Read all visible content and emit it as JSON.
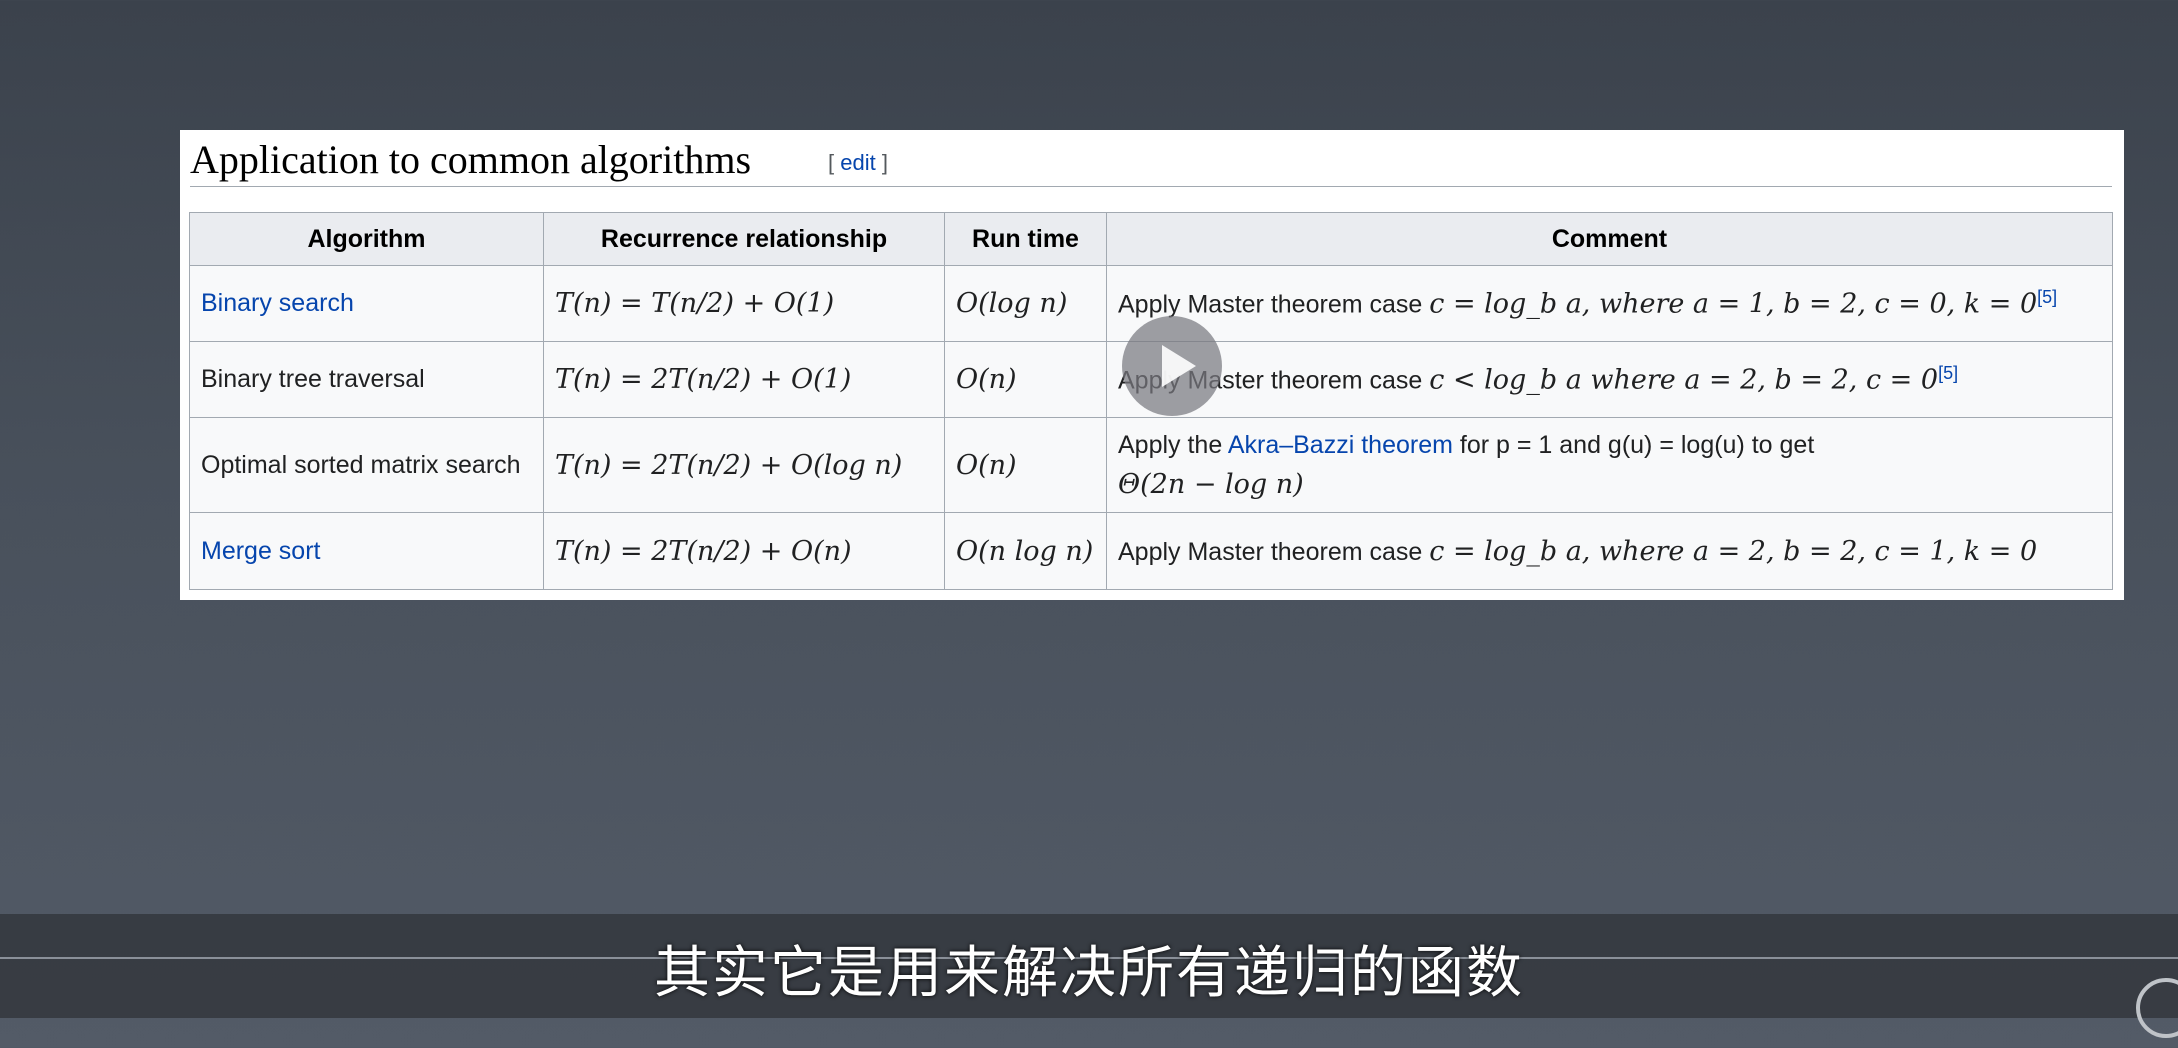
{
  "section": {
    "title": "Application to common algorithms",
    "edit_bracket_open": "[",
    "edit_label": "edit",
    "edit_bracket_close": "]"
  },
  "table": {
    "headers": [
      "Algorithm",
      "Recurrence relationship",
      "Run time",
      "Comment"
    ],
    "rows": [
      {
        "algorithm": "Binary search",
        "algorithm_is_link": true,
        "recurrence": "T(n) = T(n/2) + O(1)",
        "runtime": "O(log n)",
        "comment_pre": "Apply Master theorem case",
        "comment_math": "c = log_b a, where a = 1, b = 2, c = 0, k = 0",
        "ref": "[5]"
      },
      {
        "algorithm": "Binary tree traversal",
        "algorithm_is_link": false,
        "recurrence": "T(n) = 2T(n/2) + O(1)",
        "runtime": "O(n)",
        "comment_pre": "Apply Master theorem case",
        "comment_math": "c < log_b a where a = 2, b = 2, c = 0",
        "ref": "[5]"
      },
      {
        "algorithm": "Optimal sorted matrix search",
        "algorithm_is_link": false,
        "recurrence": "T(n) = 2T(n/2) + O(log n)",
        "runtime": "O(n)",
        "comment_pre": "Apply the",
        "comment_link": "Akra–Bazzi theorem",
        "comment_mid": "for p = 1 and g(u) = log(u) to get",
        "comment_math": "Θ(2n − log n)"
      },
      {
        "algorithm": "Merge sort",
        "algorithm_is_link": true,
        "recurrence": "T(n) = 2T(n/2) + O(n)",
        "runtime": "O(n log n)",
        "comment_pre": "Apply Master theorem case",
        "comment_math": "c = log_b a, where a = 2, b = 2, c = 1, k = 0"
      }
    ]
  },
  "player": {
    "play_icon": "play-icon"
  },
  "subtitle": "其实它是用来解决所有递归的函数",
  "colors": {
    "link": "#0645ad",
    "header_bg": "#eaecf0",
    "cell_bg": "#f8f9fa",
    "border": "#a2a9b1"
  }
}
